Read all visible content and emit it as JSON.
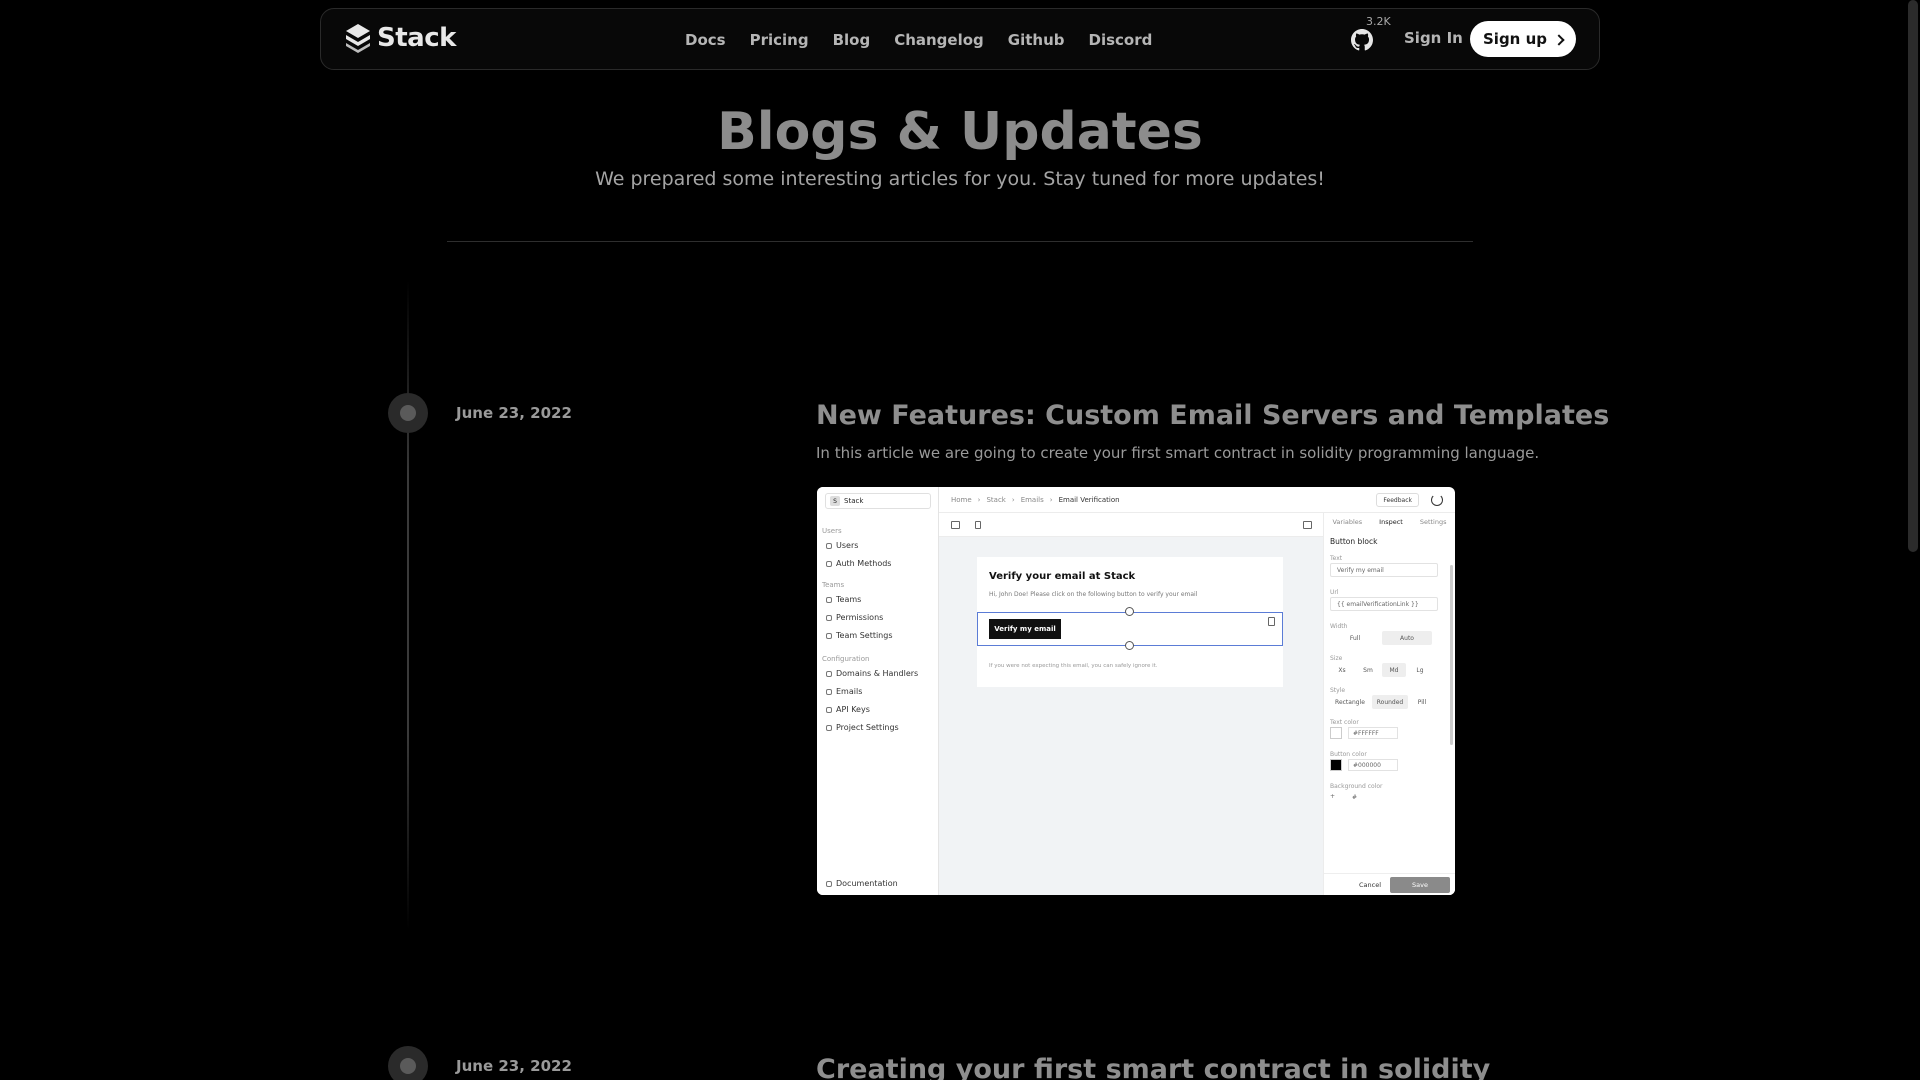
{
  "nav": {
    "brand": "Stack",
    "links": [
      "Docs",
      "Pricing",
      "Blog",
      "Changelog",
      "Github",
      "Discord"
    ],
    "github_stars": "3.2K",
    "signin": "Sign In",
    "signup": "Sign up"
  },
  "hero": {
    "title": "Blogs & Updates",
    "subtitle": "We prepared some interesting articles for you. Stay tuned for more updates!"
  },
  "posts": [
    {
      "date": "June 23, 2022",
      "title": "New Features: Custom Email Servers and Templates",
      "description": "In this article we are going to create your first smart contract in solidity programming language."
    },
    {
      "date": "June 23, 2022",
      "title": "Creating your first smart contract in solidity"
    }
  ],
  "screenshot": {
    "project": "Stack",
    "project_badge": "S",
    "sections": {
      "users": "Users",
      "teams": "Teams",
      "config": "Configuration"
    },
    "items": {
      "users": "Users",
      "auth": "Auth Methods",
      "teams": "Teams",
      "perms": "Permissions",
      "team_settings": "Team Settings",
      "domains": "Domains & Handlers",
      "emails": "Emails",
      "api_keys": "API Keys",
      "project_settings": "Project Settings",
      "docs": "Documentation"
    },
    "breadcrumb": [
      "Home",
      "Stack",
      "Emails",
      "Email Verification"
    ],
    "feedback": "Feedback",
    "email_heading": "Verify your email at Stack",
    "email_body": "Hi, John Doe! Please click on the following button to verify your email",
    "verify_button": "Verify my email",
    "email_footer": "If you were not expecting this email, you can safely ignore it.",
    "panel_tabs": [
      "Variables",
      "Inspect",
      "Settings"
    ],
    "panel_title": "Button block",
    "labels": {
      "text": "Text",
      "url": "Url",
      "width": "Width",
      "size": "Size",
      "style": "Style",
      "text_color": "Text color",
      "button_color": "Button color",
      "bg_color": "Background color"
    },
    "text_value": "Verify my email",
    "url_value": "{{ emailVerificationLink }}",
    "width_opts": [
      "Full",
      "Auto"
    ],
    "size_opts": [
      "Xs",
      "Sm",
      "Md",
      "Lg"
    ],
    "style_opts": [
      "Rectangle",
      "Rounded",
      "Pill"
    ],
    "text_color_value": "#FFFFFF",
    "button_color_value": "#000000",
    "bg_color_value": "#",
    "cancel": "Cancel",
    "save": "Save"
  }
}
